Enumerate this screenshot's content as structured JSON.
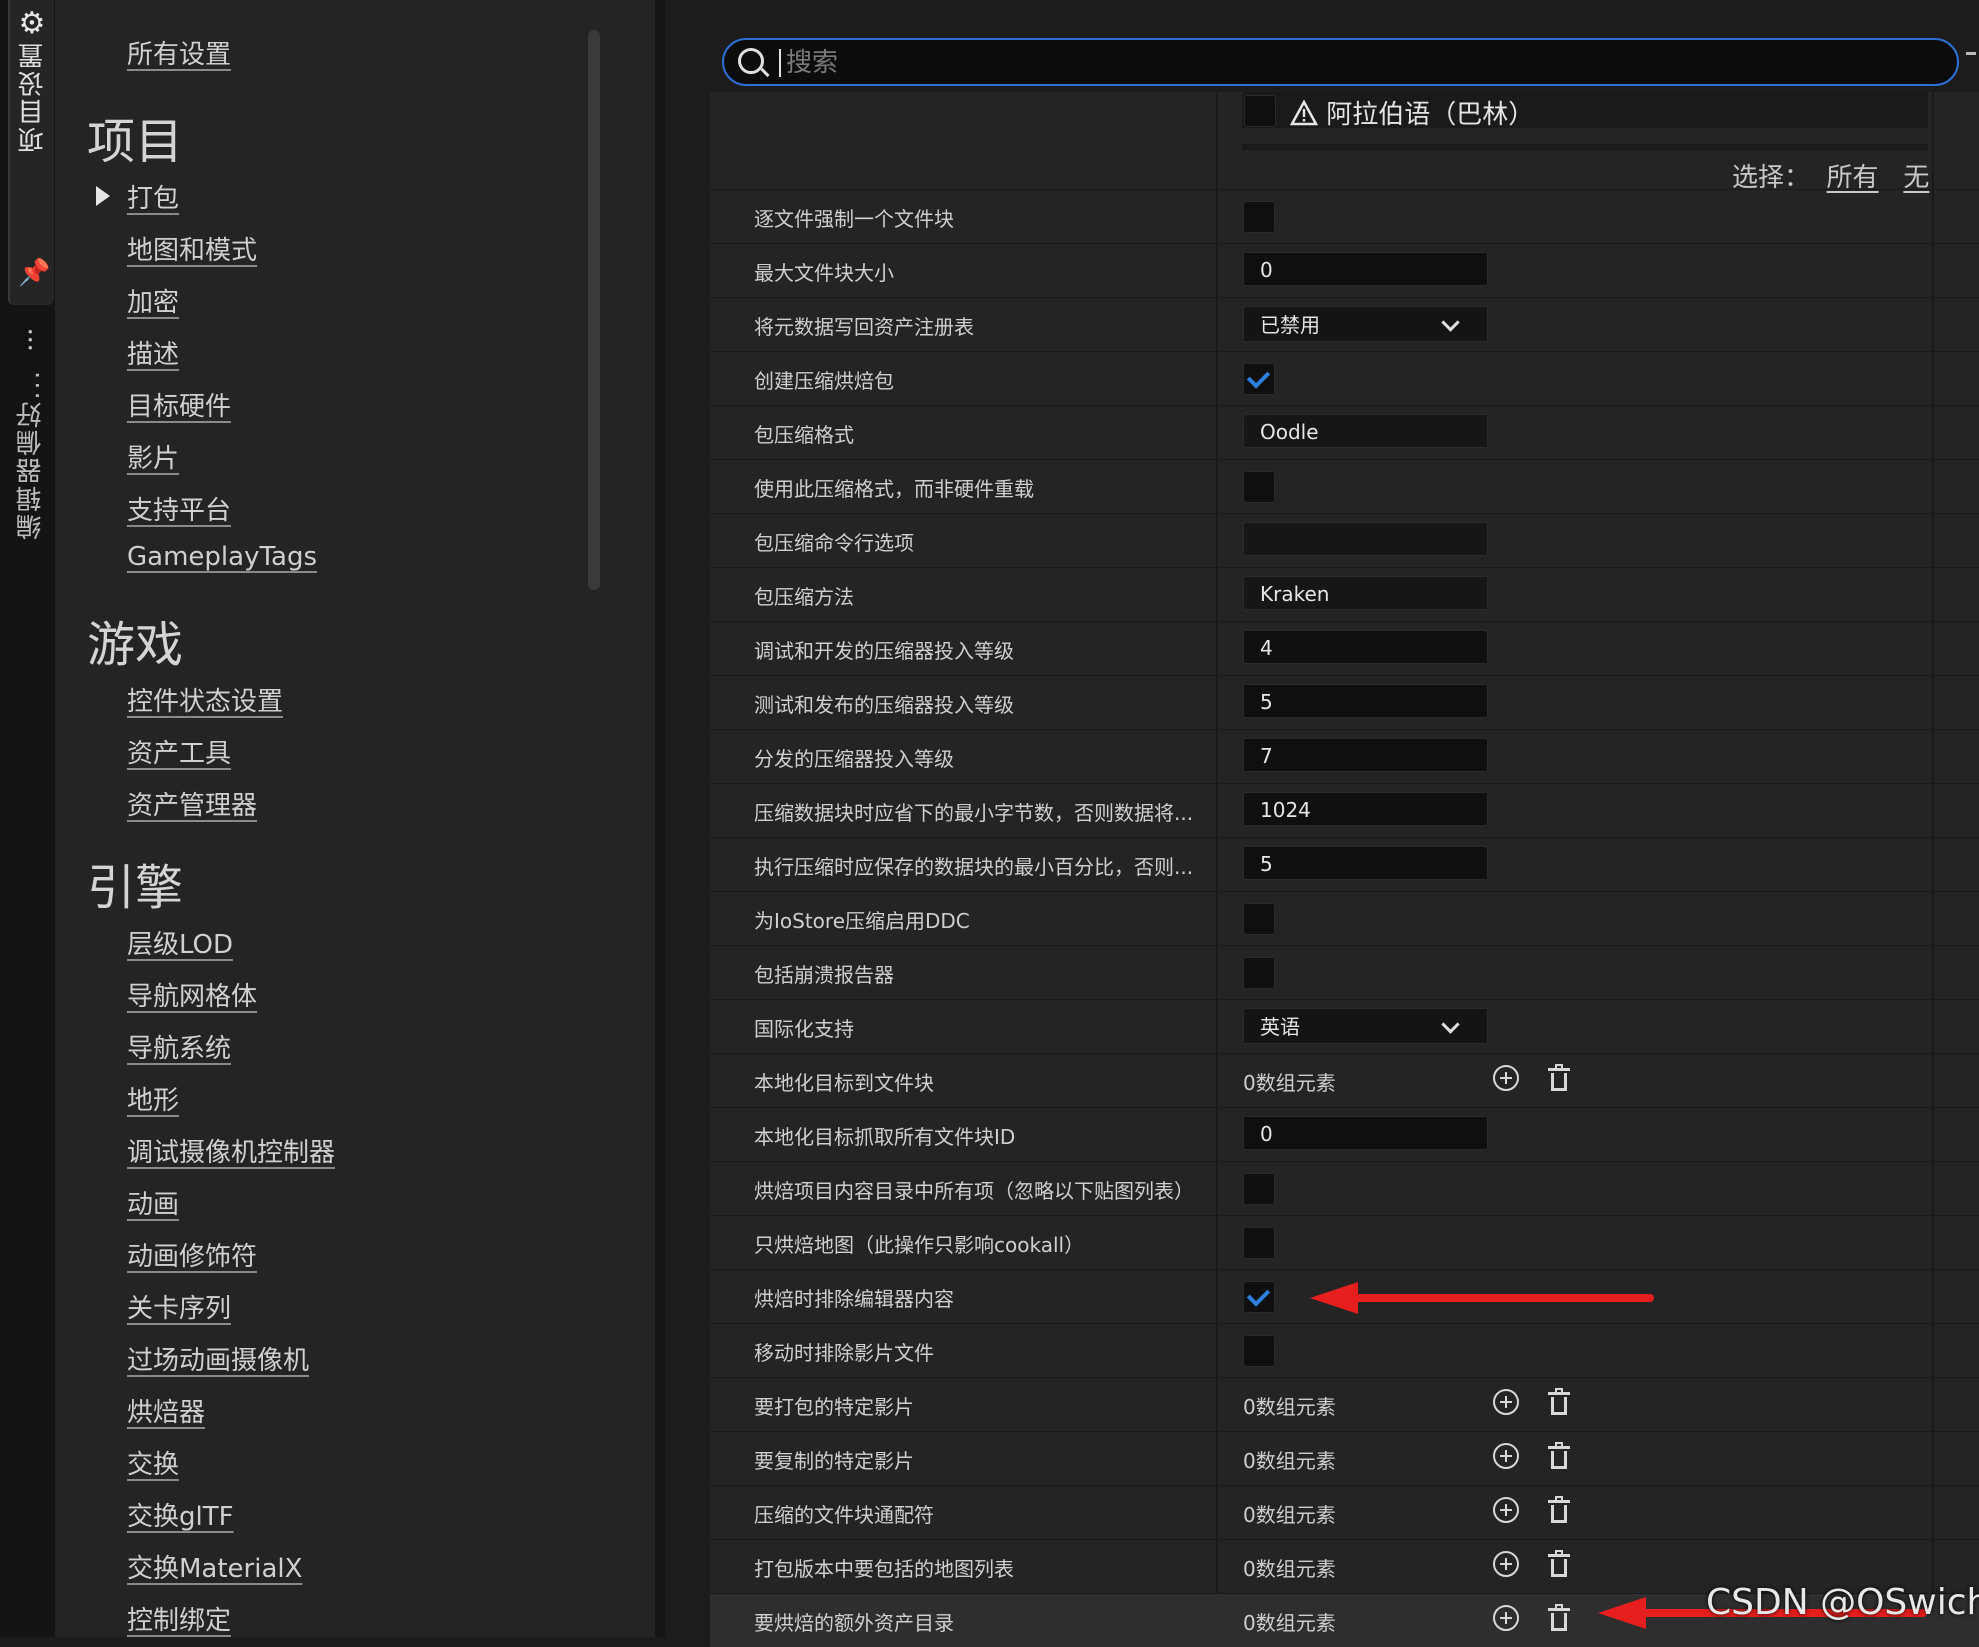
{
  "side_tabs": {
    "project_settings": "项目设置",
    "editor_prefs": "编辑器偏好..."
  },
  "nav": {
    "all_settings": "所有设置",
    "sections": [
      {
        "title": "项目",
        "items": [
          "打包",
          "地图和模式",
          "加密",
          "描述",
          "目标硬件",
          "影片",
          "支持平台",
          "GameplayTags"
        ]
      },
      {
        "title": "游戏",
        "items": [
          "控件状态设置",
          "资产工具",
          "资产管理器"
        ]
      },
      {
        "title": "引擎",
        "items": [
          "层级LOD",
          "导航网格体",
          "导航系统",
          "地形",
          "调试摄像机控制器",
          "动画",
          "动画修饰符",
          "关卡序列",
          "过场动画摄像机",
          "烘焙器",
          "交换",
          "交换glTF",
          "交换MaterialX",
          "控制绑定"
        ]
      }
    ]
  },
  "search": {
    "placeholder": "搜索",
    "value": ""
  },
  "language": {
    "label": "阿拉伯语（巴林）",
    "checked": false
  },
  "select": {
    "label": "选择：",
    "all": "所有",
    "none": "无"
  },
  "rows": [
    {
      "label": "逐文件强制一个文件块",
      "type": "check",
      "value": false
    },
    {
      "label": "最大文件块大小",
      "type": "number",
      "value": "0"
    },
    {
      "label": "将元数据写回资产注册表",
      "type": "dropdown",
      "value": "已禁用"
    },
    {
      "label": "创建压缩烘焙包",
      "type": "check",
      "value": true
    },
    {
      "label": "包压缩格式",
      "type": "text",
      "value": "Oodle"
    },
    {
      "label": "使用此压缩格式，而非硬件重载",
      "type": "check",
      "value": false
    },
    {
      "label": "包压缩命令行选项",
      "type": "text",
      "value": ""
    },
    {
      "label": "包压缩方法",
      "type": "text",
      "value": "Kraken"
    },
    {
      "label": "调试和开发的压缩器投入等级",
      "type": "number",
      "value": "4"
    },
    {
      "label": "测试和发布的压缩器投入等级",
      "type": "number",
      "value": "5"
    },
    {
      "label": "分发的压缩器投入等级",
      "type": "number",
      "value": "7"
    },
    {
      "label": "压缩数据块时应省下的最小字节数，否则数据将...",
      "type": "number",
      "value": "1024"
    },
    {
      "label": "执行压缩时应保存的数据块的最小百分比，否则...",
      "type": "number",
      "value": "5"
    },
    {
      "label": "为IoStore压缩启用DDC",
      "type": "check",
      "value": false
    },
    {
      "label": "包括崩溃报告器",
      "type": "check",
      "value": false
    },
    {
      "label": "国际化支持",
      "type": "dropdown",
      "value": "英语"
    },
    {
      "label": "本地化目标到文件块",
      "type": "array",
      "value": "0数组元素"
    },
    {
      "label": "本地化目标抓取所有文件块ID",
      "type": "number",
      "value": "0"
    },
    {
      "label": "烘焙项目内容目录中所有项（忽略以下贴图列表）",
      "type": "check",
      "value": false
    },
    {
      "label": "只烘焙地图（此操作只影响cookall）",
      "type": "check",
      "value": false
    },
    {
      "label": "烘焙时排除编辑器内容",
      "type": "check",
      "value": true
    },
    {
      "label": "移动时排除影片文件",
      "type": "check",
      "value": false
    },
    {
      "label": "要打包的特定影片",
      "type": "array",
      "value": "0数组元素"
    },
    {
      "label": "要复制的特定影片",
      "type": "array",
      "value": "0数组元素"
    },
    {
      "label": "压缩的文件块通配符",
      "type": "array",
      "value": "0数组元素"
    },
    {
      "label": "打包版本中要包括的地图列表",
      "type": "array",
      "value": "0数组元素"
    },
    {
      "label": "要烘焙的额外资产目录",
      "type": "array",
      "value": "0数组元素"
    }
  ],
  "colors": {
    "accent": "#2d6fd6",
    "check": "#2f7fe0",
    "annotation_arrow": "#e61e1e"
  },
  "watermark": "CSDN @OSwich"
}
